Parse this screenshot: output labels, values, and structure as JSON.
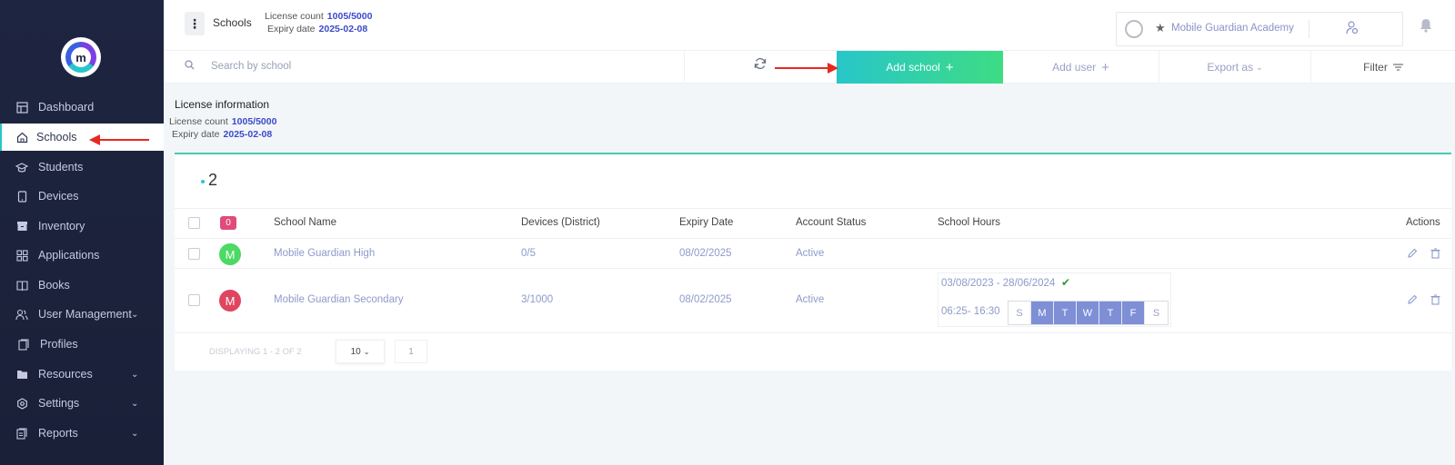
{
  "sidebar": {
    "logo_letter": "m",
    "items": [
      {
        "label": "Dashboard",
        "icon": "dashboard-icon",
        "has_chevron": false
      },
      {
        "label": "Schools",
        "icon": "home-icon",
        "has_chevron": false,
        "active": true
      },
      {
        "label": "Students",
        "icon": "graduation-cap-icon",
        "has_chevron": false
      },
      {
        "label": "Devices",
        "icon": "tablet-icon",
        "has_chevron": false
      },
      {
        "label": "Inventory",
        "icon": "box-icon",
        "has_chevron": false
      },
      {
        "label": "Applications",
        "icon": "grid-icon",
        "has_chevron": false
      },
      {
        "label": "Books",
        "icon": "book-icon",
        "has_chevron": false
      },
      {
        "label": "User Management",
        "icon": "users-icon",
        "has_chevron": true
      },
      {
        "label": "Profiles",
        "icon": "profile-card-icon",
        "has_chevron": false
      },
      {
        "label": "Resources",
        "icon": "folder-icon",
        "has_chevron": true
      },
      {
        "label": "Settings",
        "icon": "gear-icon",
        "has_chevron": true
      },
      {
        "label": "Reports",
        "icon": "report-icon",
        "has_chevron": true
      }
    ]
  },
  "header": {
    "breadcrumb": "Schools",
    "license_count_label": "License count",
    "license_count_value": "1005/5000",
    "expiry_label": "Expiry date",
    "expiry_value": "2025-02-08",
    "account_name": "Mobile Guardian Academy"
  },
  "toolbar": {
    "search_placeholder": "Search by school",
    "add_school_label": "Add school",
    "add_user_label": "Add user",
    "export_label": "Export as",
    "filter_label": "Filter"
  },
  "license_panel": {
    "title": "License information",
    "count_label": "License count",
    "count_value": "1005/5000",
    "expiry_label": "Expiry date",
    "expiry_value": "2025-02-08"
  },
  "table": {
    "count": "2",
    "selected_badge": "0",
    "columns": [
      "School Name",
      "Devices (District)",
      "Expiry Date",
      "Account Status",
      "School Hours",
      "Actions"
    ],
    "rows": [
      {
        "initial": "M",
        "avatar_color": "#4cd964",
        "name": "Mobile Guardian High",
        "devices": "0/5",
        "expiry": "08/02/2025",
        "status": "Active"
      },
      {
        "initial": "M",
        "avatar_color": "#e0455f",
        "name": "Mobile Guardian Secondary",
        "devices": "3/1000",
        "expiry": "08/02/2025",
        "status": "Active",
        "hours_range": "03/08/2023 - 28/06/2024",
        "hours_time": "06:25- 16:30",
        "days": [
          {
            "d": "S",
            "on": false
          },
          {
            "d": "M",
            "on": true
          },
          {
            "d": "T",
            "on": true
          },
          {
            "d": "W",
            "on": true
          },
          {
            "d": "T",
            "on": true
          },
          {
            "d": "F",
            "on": true
          },
          {
            "d": "S",
            "on": false
          }
        ]
      }
    ]
  },
  "pagination": {
    "display_text": "DISPLAYING 1 - 2 OF 2",
    "page_size": "10",
    "current_page": "1"
  },
  "colors": {
    "sidebar_bg": "#1e2540",
    "accent_teal": "#28c6c9",
    "accent_green": "#3ddc84",
    "link_blue": "#3b4bc8",
    "annotation_red": "#e8281f"
  }
}
